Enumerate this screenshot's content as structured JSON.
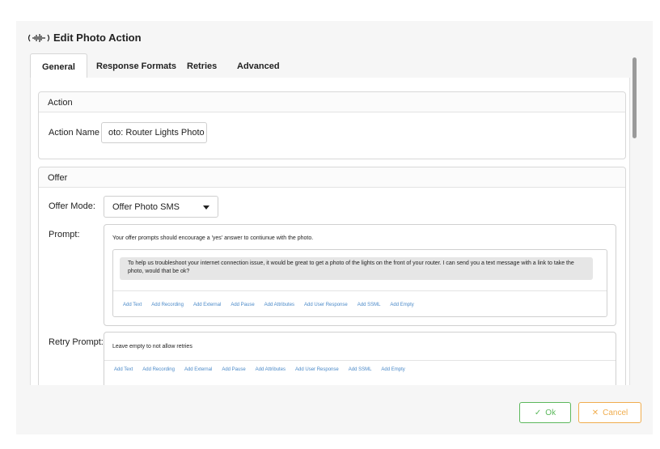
{
  "dialog": {
    "title": "Edit Photo Action",
    "title_icon": "sound-wave-icon"
  },
  "tabs": [
    {
      "label": "General",
      "active": true
    },
    {
      "label": "Response Formats",
      "active": false
    },
    {
      "label": "Retries",
      "active": false
    },
    {
      "label": "Advanced",
      "active": false
    }
  ],
  "action_section": {
    "header": "Action",
    "name_label": "Action Name",
    "name_value": "oto: Router Lights Photo"
  },
  "offer_section": {
    "header": "Offer",
    "mode_label": "Offer Mode:",
    "mode_value": "Offer Photo SMS",
    "prompt_label": "Prompt:",
    "prompt_hint": "Your offer prompts should encourage a 'yes' answer to contiunue with the photo.",
    "prompt_text": "To help us troubleshoot your internet connection issue, it would be great to get a photo of the lights on the front of your router. I can send you a text message with a link to take the photo, would that be ok?",
    "prompt_links": [
      "Add Text",
      "Add Recording",
      "Add External",
      "Add Pause",
      "Add Attributes",
      "Add User Response",
      "Add SSML",
      "Add Empty"
    ],
    "retry_label": "Retry Prompt:",
    "retry_hint": "Leave empty to not allow retries",
    "retry_links": [
      "Add Text",
      "Add Recording",
      "Add External",
      "Add Pause",
      "Add Attributes",
      "Add User Response",
      "Add SSML",
      "Add Empty"
    ]
  },
  "footer": {
    "ok_label": "Ok",
    "cancel_label": "Cancel"
  },
  "colors": {
    "ok": "#5cb85c",
    "cancel": "#f0ad4e",
    "link": "#4a89c8"
  }
}
